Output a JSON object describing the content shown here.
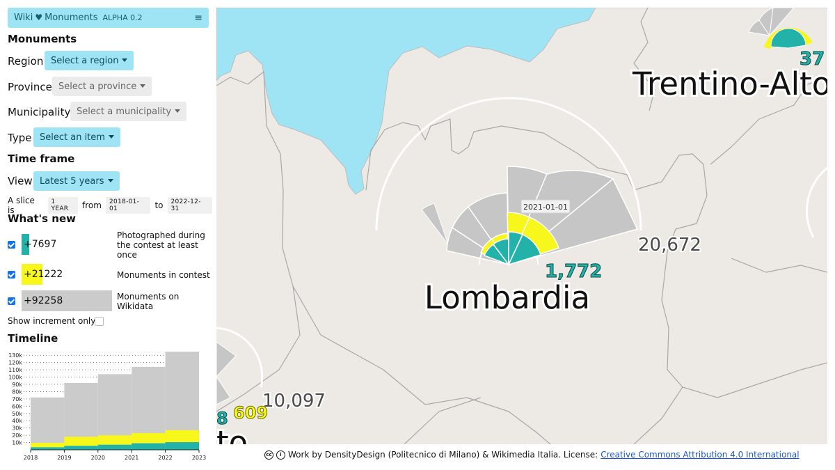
{
  "app": {
    "name_left": "Wiki",
    "name_right": "Monuments",
    "version": "ALPHA 0.2"
  },
  "monuments": {
    "heading": "Monuments",
    "region_label": "Region",
    "region_value": "Select a region",
    "province_label": "Province",
    "province_value": "Select a province",
    "municipality_label": "Municipality",
    "municipality_value": "Select a municipality",
    "type_label": "Type",
    "type_value": "Select an item"
  },
  "timeframe": {
    "heading": "Time frame",
    "view_label": "View",
    "view_value": "Latest 5 years",
    "slice_prefix": "A slice is",
    "slice_unit": "1 YEAR",
    "from_label": "from",
    "from_date": "2018-01-01",
    "to_label": "to",
    "to_date": "2022-12-31"
  },
  "whats_new": {
    "heading": "What's new",
    "items": [
      {
        "value": "+7697",
        "desc": "Photographed during the contest at least once",
        "color": "#23b2a9",
        "checked": true
      },
      {
        "value": "+21222",
        "desc": "Monuments in contest",
        "color": "#f7f71c",
        "checked": true
      },
      {
        "value": "+92258",
        "desc": "Monuments on Wikidata",
        "color": "#cbcbcb",
        "checked": true
      }
    ],
    "show_increment_label": "Show increment only"
  },
  "timeline": {
    "heading": "Timeline"
  },
  "chart_data": {
    "type": "area",
    "x": [
      "2018",
      "2019",
      "2020",
      "2021",
      "2022",
      "2023"
    ],
    "yticks": [
      "130k",
      "120k",
      "110k",
      "100k",
      "90k",
      "80k",
      "70k",
      "60k",
      "50k",
      "40k",
      "30k",
      "20k",
      "10k"
    ],
    "ylim": [
      0,
      135000
    ],
    "series": [
      {
        "name": "Photographed during the contest at least once",
        "color": "#23b2a9",
        "values": [
          2500,
          3500,
          5500,
          7000,
          9000,
          10500
        ]
      },
      {
        "name": "Monuments in contest",
        "color": "#f7f71c",
        "values": [
          7000,
          9500,
          18000,
          20000,
          23000,
          27000
        ]
      },
      {
        "name": "Monuments on Wikidata",
        "color": "#cbcbcb",
        "values": [
          66000,
          72000,
          92000,
          104000,
          114000,
          135000
        ]
      }
    ]
  },
  "map": {
    "tooltip_date": "2021-01-01",
    "region_lombardia": "Lombardia",
    "lombardia_wikidata": "20,672",
    "lombardia_photo": "1,772",
    "region_trentino": "Trentino-Alto",
    "trentino_number": "37",
    "veneto_wikidata": "10,097",
    "veneto_contest": "609",
    "veneto_photo": "8",
    "veneto_name": "to"
  },
  "footer": {
    "text": "Work by DensityDesign (Politecnico di Milano) & Wikimedia Italia. License:",
    "link": "Creative Commons Attribution 4.0 International"
  },
  "colors": {
    "accent": "#9fe4f5",
    "teal": "#23b2a9",
    "yellow": "#f7f71c",
    "grey": "#cbcbcb",
    "water": "#9fe4f5",
    "land": "#ede9e5"
  }
}
